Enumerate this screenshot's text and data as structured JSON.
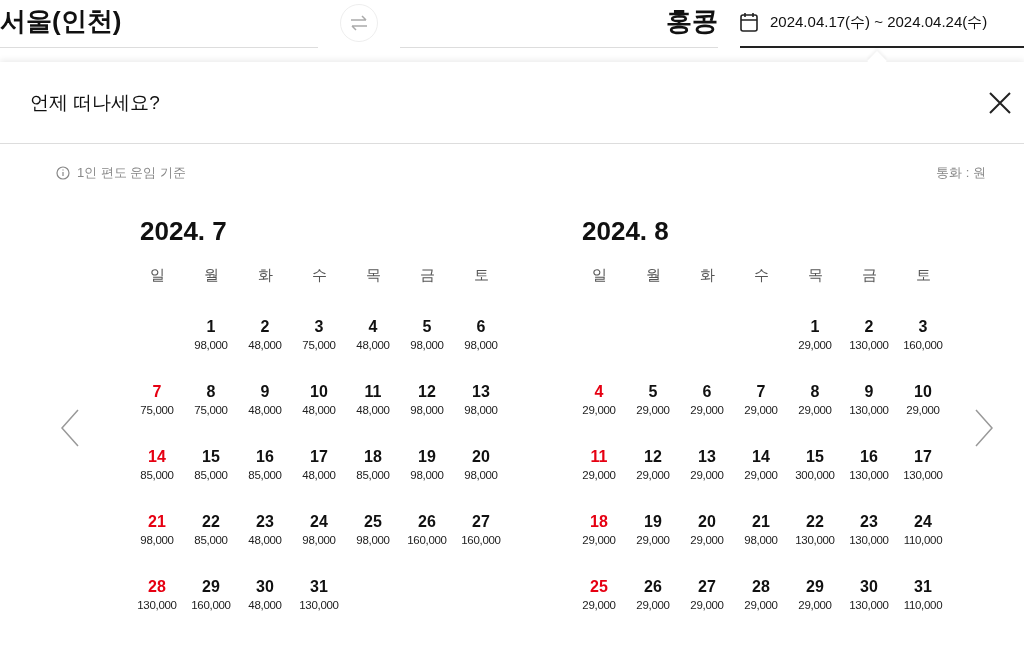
{
  "search": {
    "origin": "서울(인천)",
    "destination": "홍콩",
    "dates": "2024.04.17(수) ~ 2024.04.24(수)"
  },
  "panel": {
    "title": "언제 떠나세요?",
    "note": "1인 편도 운임 기준",
    "currency": "통화 : 원"
  },
  "months": [
    {
      "title": "2024. 7",
      "weekdays": [
        "일",
        "월",
        "화",
        "수",
        "목",
        "금",
        "토"
      ],
      "days": [
        {
          "kind": "blank"
        },
        {
          "kind": "weekday",
          "day": "1",
          "price": "98,000"
        },
        {
          "kind": "weekday",
          "day": "2",
          "price": "48,000"
        },
        {
          "kind": "weekday",
          "day": "3",
          "price": "75,000"
        },
        {
          "kind": "weekday",
          "day": "4",
          "price": "48,000"
        },
        {
          "kind": "weekday",
          "day": "5",
          "price": "98,000"
        },
        {
          "kind": "weekday",
          "day": "6",
          "price": "98,000"
        },
        {
          "kind": "sunday",
          "day": "7",
          "price": "75,000"
        },
        {
          "kind": "weekday",
          "day": "8",
          "price": "75,000"
        },
        {
          "kind": "weekday",
          "day": "9",
          "price": "48,000"
        },
        {
          "kind": "weekday",
          "day": "10",
          "price": "48,000"
        },
        {
          "kind": "weekday",
          "day": "11",
          "price": "48,000"
        },
        {
          "kind": "weekday",
          "day": "12",
          "price": "98,000"
        },
        {
          "kind": "weekday",
          "day": "13",
          "price": "98,000"
        },
        {
          "kind": "sunday",
          "day": "14",
          "price": "85,000"
        },
        {
          "kind": "weekday",
          "day": "15",
          "price": "85,000"
        },
        {
          "kind": "weekday",
          "day": "16",
          "price": "85,000"
        },
        {
          "kind": "weekday",
          "day": "17",
          "price": "48,000"
        },
        {
          "kind": "weekday",
          "day": "18",
          "price": "85,000"
        },
        {
          "kind": "weekday",
          "day": "19",
          "price": "98,000"
        },
        {
          "kind": "weekday",
          "day": "20",
          "price": "98,000"
        },
        {
          "kind": "sunday",
          "day": "21",
          "price": "98,000"
        },
        {
          "kind": "weekday",
          "day": "22",
          "price": "85,000"
        },
        {
          "kind": "weekday",
          "day": "23",
          "price": "48,000"
        },
        {
          "kind": "weekday",
          "day": "24",
          "price": "98,000"
        },
        {
          "kind": "weekday",
          "day": "25",
          "price": "98,000"
        },
        {
          "kind": "weekday",
          "day": "26",
          "price": "160,000"
        },
        {
          "kind": "weekday",
          "day": "27",
          "price": "160,000"
        },
        {
          "kind": "sunday",
          "day": "28",
          "price": "130,000"
        },
        {
          "kind": "weekday",
          "day": "29",
          "price": "160,000"
        },
        {
          "kind": "weekday",
          "day": "30",
          "price": "48,000"
        },
        {
          "kind": "weekday",
          "day": "31",
          "price": "130,000"
        }
      ]
    },
    {
      "title": "2024. 8",
      "weekdays": [
        "일",
        "월",
        "화",
        "수",
        "목",
        "금",
        "토"
      ],
      "days": [
        {
          "kind": "blank"
        },
        {
          "kind": "blank"
        },
        {
          "kind": "blank"
        },
        {
          "kind": "blank"
        },
        {
          "kind": "weekday",
          "day": "1",
          "price": "29,000"
        },
        {
          "kind": "weekday",
          "day": "2",
          "price": "130,000"
        },
        {
          "kind": "weekday",
          "day": "3",
          "price": "160,000"
        },
        {
          "kind": "sunday",
          "day": "4",
          "price": "29,000"
        },
        {
          "kind": "weekday",
          "day": "5",
          "price": "29,000"
        },
        {
          "kind": "weekday",
          "day": "6",
          "price": "29,000"
        },
        {
          "kind": "weekday",
          "day": "7",
          "price": "29,000"
        },
        {
          "kind": "weekday",
          "day": "8",
          "price": "29,000"
        },
        {
          "kind": "weekday",
          "day": "9",
          "price": "130,000"
        },
        {
          "kind": "weekday",
          "day": "10",
          "price": "29,000"
        },
        {
          "kind": "sunday",
          "day": "11",
          "price": "29,000"
        },
        {
          "kind": "weekday",
          "day": "12",
          "price": "29,000"
        },
        {
          "kind": "weekday",
          "day": "13",
          "price": "29,000"
        },
        {
          "kind": "weekday",
          "day": "14",
          "price": "29,000"
        },
        {
          "kind": "weekday",
          "day": "15",
          "price": "300,000"
        },
        {
          "kind": "weekday",
          "day": "16",
          "price": "130,000"
        },
        {
          "kind": "weekday",
          "day": "17",
          "price": "130,000"
        },
        {
          "kind": "sunday",
          "day": "18",
          "price": "29,000"
        },
        {
          "kind": "weekday",
          "day": "19",
          "price": "29,000"
        },
        {
          "kind": "weekday",
          "day": "20",
          "price": "29,000"
        },
        {
          "kind": "weekday",
          "day": "21",
          "price": "98,000"
        },
        {
          "kind": "weekday",
          "day": "22",
          "price": "130,000"
        },
        {
          "kind": "weekday",
          "day": "23",
          "price": "130,000"
        },
        {
          "kind": "weekday",
          "day": "24",
          "price": "110,000"
        },
        {
          "kind": "sunday",
          "day": "25",
          "price": "29,000"
        },
        {
          "kind": "weekday",
          "day": "26",
          "price": "29,000"
        },
        {
          "kind": "weekday",
          "day": "27",
          "price": "29,000"
        },
        {
          "kind": "weekday",
          "day": "28",
          "price": "29,000"
        },
        {
          "kind": "weekday",
          "day": "29",
          "price": "29,000"
        },
        {
          "kind": "weekday",
          "day": "30",
          "price": "130,000"
        },
        {
          "kind": "weekday",
          "day": "31",
          "price": "110,000"
        }
      ]
    }
  ]
}
